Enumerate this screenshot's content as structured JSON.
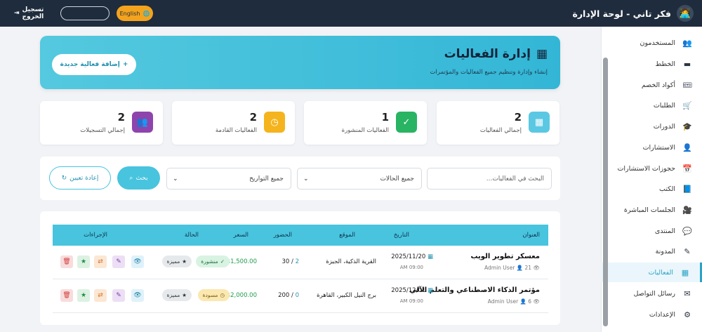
{
  "app": {
    "title": "فكر تاني - لوحة الإدارة",
    "language_label": "English",
    "logout_label": "تسجيل الخروج"
  },
  "sidebar": {
    "items": [
      {
        "label": "المستخدمون",
        "icon": "users-icon"
      },
      {
        "label": "الخطط",
        "icon": "card-icon"
      },
      {
        "label": "أكواد الخصم",
        "icon": "ticket-icon"
      },
      {
        "label": "الطلبات",
        "icon": "cart-icon"
      },
      {
        "label": "الدورات",
        "icon": "graduation-icon"
      },
      {
        "label": "الاستشارات",
        "icon": "user-tie-icon"
      },
      {
        "label": "حجوزات الاستشارات",
        "icon": "calendar-check-icon"
      },
      {
        "label": "الكتب",
        "icon": "book-icon"
      },
      {
        "label": "الجلسات المباشرة",
        "icon": "video-icon"
      },
      {
        "label": "المنتدى",
        "icon": "comments-icon"
      },
      {
        "label": "المدونة",
        "icon": "blog-icon"
      },
      {
        "label": "الفعاليات",
        "icon": "calendar-icon",
        "active": true
      },
      {
        "label": "رسائل التواصل",
        "icon": "envelope-icon"
      },
      {
        "label": "الإعدادات",
        "icon": "gear-icon"
      }
    ]
  },
  "hero": {
    "title": "إدارة الفعاليات",
    "subtitle": "إنشاء وإدارة وتنظيم جميع الفعاليات والمؤتمرات",
    "add_button": "إضافة فعالية جديدة"
  },
  "stats": [
    {
      "value": "2",
      "label": "إجمالي الفعاليات",
      "color": "#5bc8e3",
      "icon": "calendar-icon"
    },
    {
      "value": "1",
      "label": "الفعاليات المنشورة",
      "color": "#28b463",
      "icon": "calendar-check-icon"
    },
    {
      "value": "2",
      "label": "الفعاليات القادمة",
      "color": "#f5b41d",
      "icon": "clock-icon"
    },
    {
      "value": "2",
      "label": "إجمالي التسجيلات",
      "color": "#8e44ad",
      "icon": "users-icon"
    }
  ],
  "filters": {
    "search_placeholder": "البحث في الفعاليات...",
    "status_value": "جميع الحالات",
    "date_value": "جميع التواريخ",
    "search_button": "بحث",
    "reset_button": "إعادة تعيين"
  },
  "table": {
    "headers": {
      "title": "العنوان",
      "date": "التاريخ",
      "location": "الموقع",
      "attendance": "الحضور",
      "price": "السعر",
      "status": "الحالة",
      "actions": "الإجراءات"
    },
    "rows": [
      {
        "title": "معسكر تطوير الويب",
        "views": "21",
        "author": "Admin User",
        "date": "2025/11/20",
        "time": "09:00 AM",
        "location": "القرية الذكية، الجيزة",
        "attendees": "2",
        "capacity": "/ 30",
        "price": "$1,500.00",
        "status": "منشورة",
        "featured": "مميزة"
      },
      {
        "title": "مؤتمر الذكاء الاصطناعي والتعلم الآلي",
        "views": "6",
        "author": "Admin User",
        "date": "2025/12/01",
        "time": "09:00 AM",
        "location": "برج النيل الكبير، القاهرة",
        "attendees": "0",
        "capacity": "/ 200",
        "price": "$2,000.00",
        "status": "مسودة",
        "featured": "مميزة"
      }
    ]
  }
}
